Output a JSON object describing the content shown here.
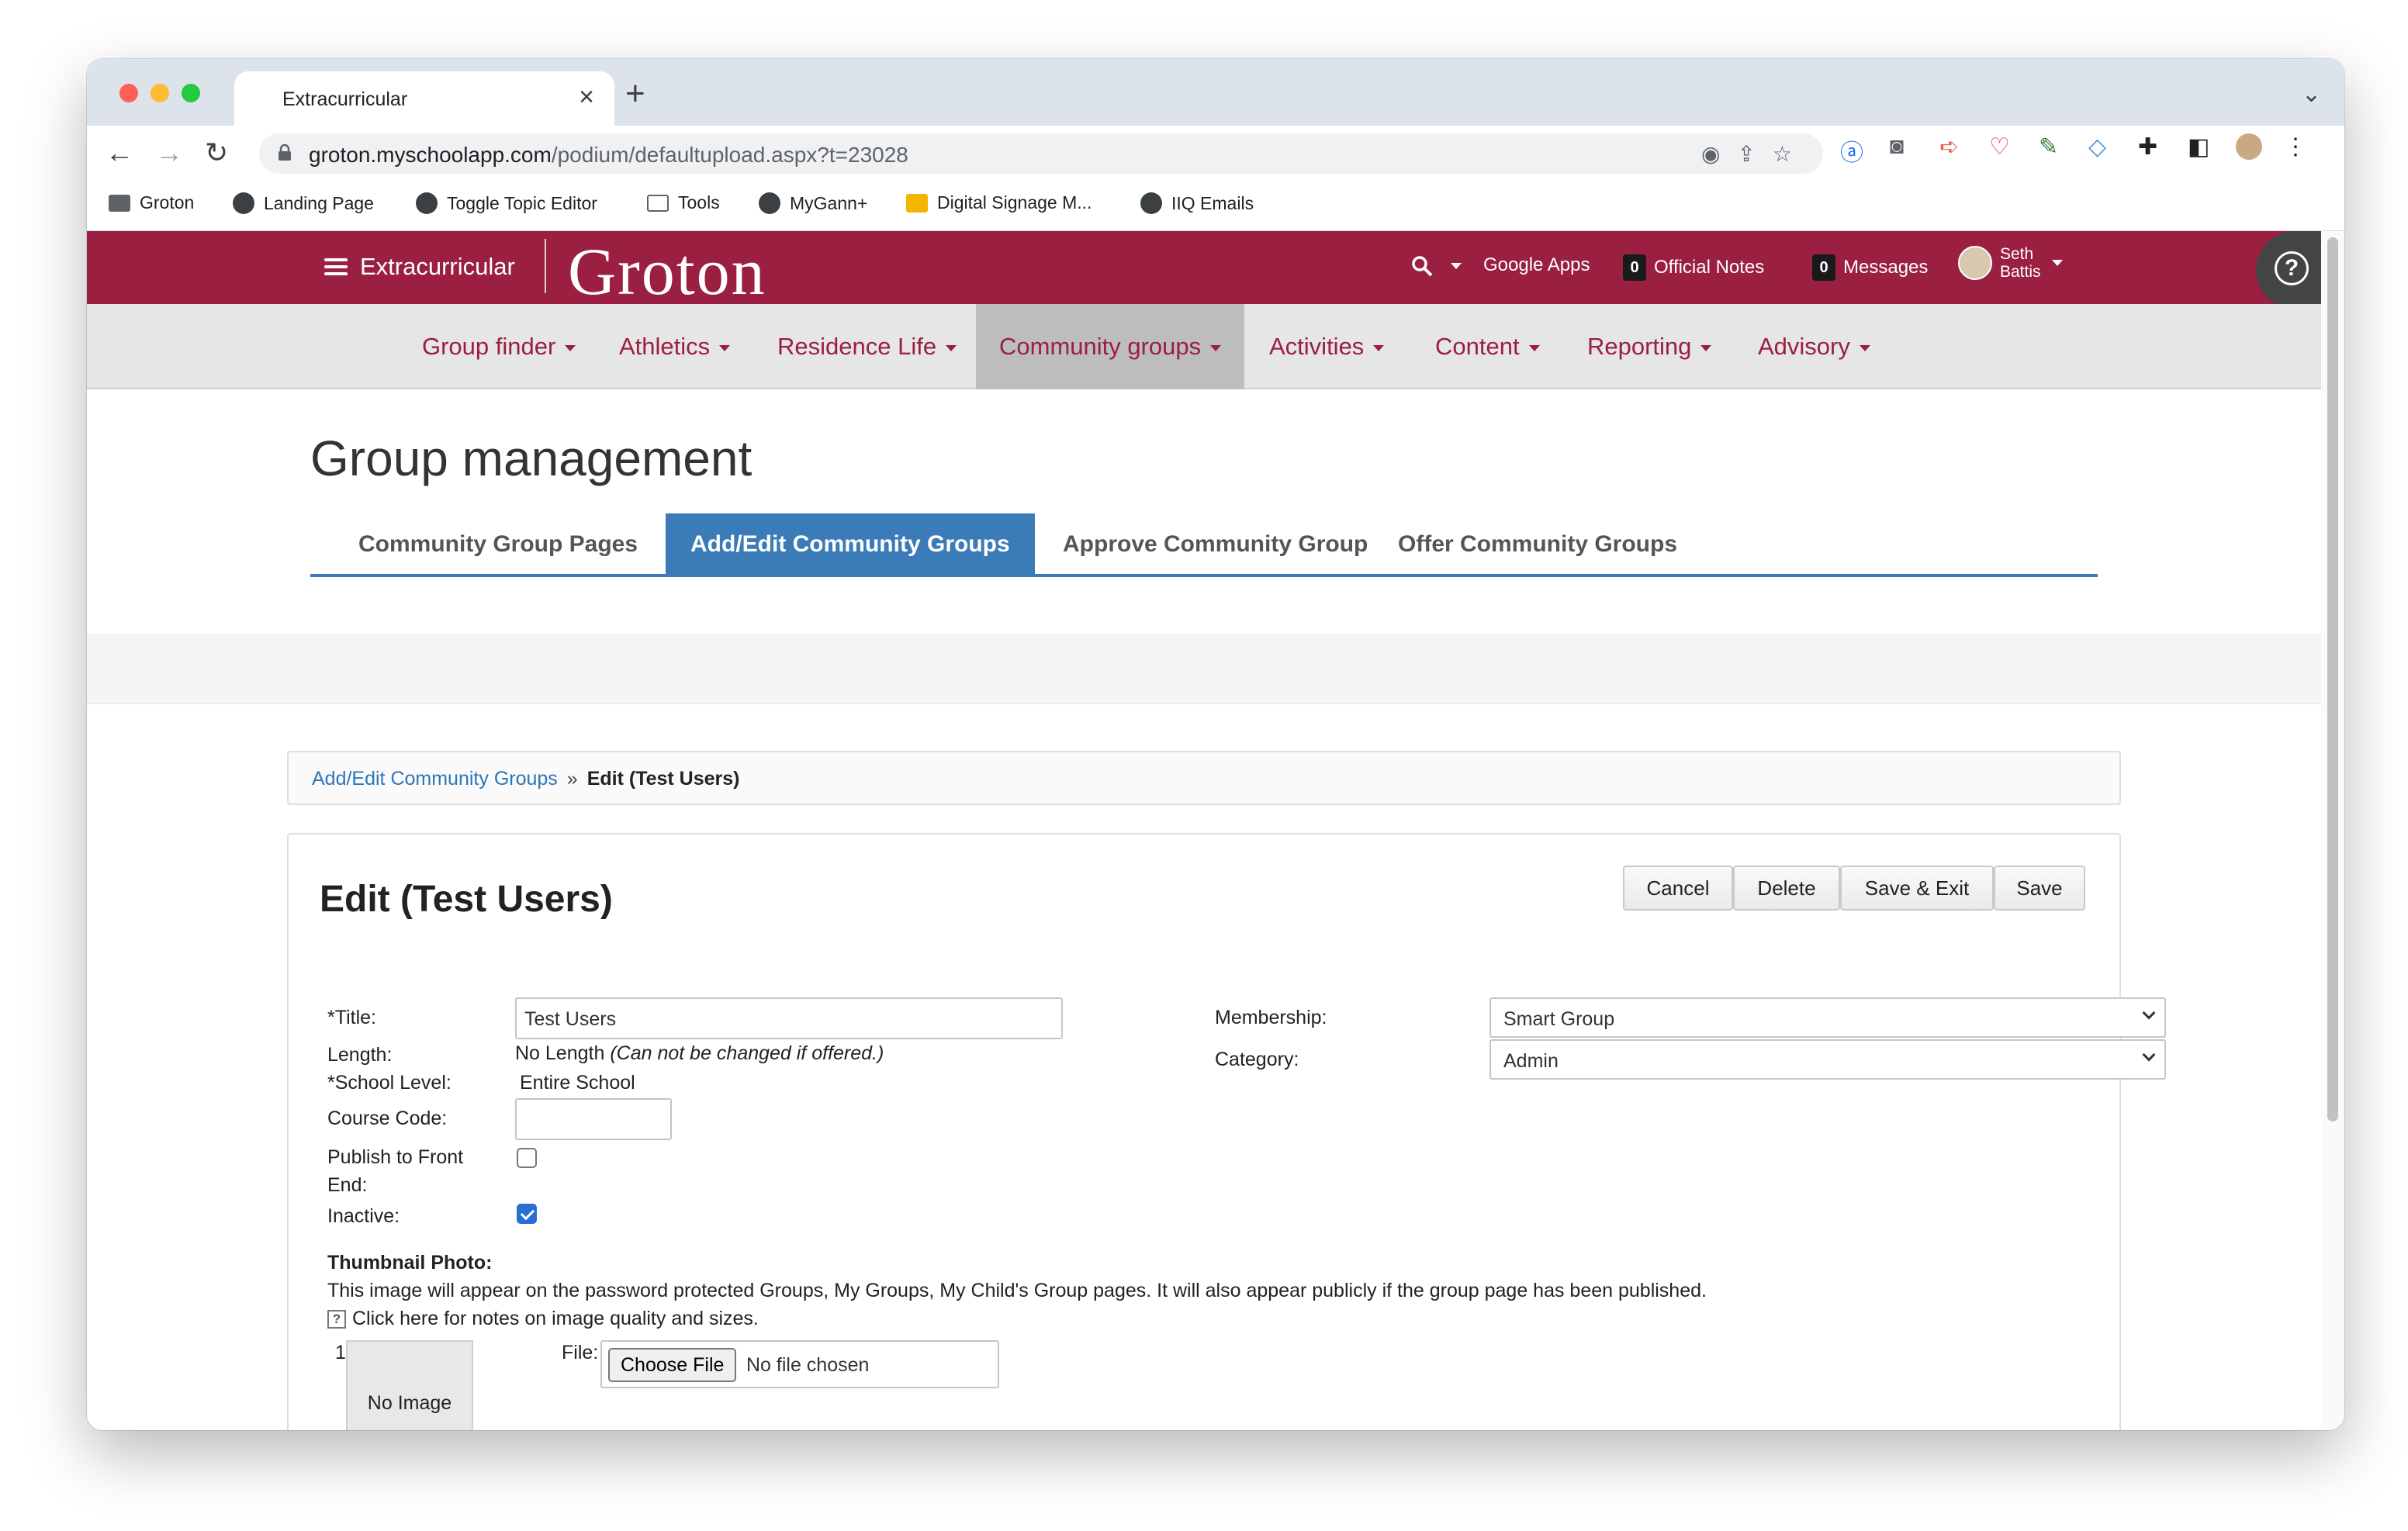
{
  "browser": {
    "tab_title": "Extracurricular",
    "url_host": "groton.myschoolapp.com",
    "url_path": "/podium/defaultupload.aspx?t=23028",
    "bookmarks": [
      "Groton",
      "Landing Page",
      "Toggle Topic Editor",
      "Tools",
      "MyGann+",
      "Digital Signage M...",
      "IIQ Emails"
    ]
  },
  "topbar": {
    "menu_label": "Extracurricular",
    "logo": "Groton",
    "google_apps": "Google Apps",
    "official_notes_count": "0",
    "official_notes": "Official Notes",
    "messages_count": "0",
    "messages": "Messages",
    "user_first": "Seth",
    "user_last": "Battis"
  },
  "mainnav": [
    "Group finder",
    "Athletics",
    "Residence Life",
    "Community groups",
    "Activities",
    "Content",
    "Reporting",
    "Advisory"
  ],
  "page": {
    "title": "Group management",
    "subtabs": [
      "Community Group Pages",
      "Add/Edit Community Groups",
      "Approve Community Group",
      "Offer Community Groups"
    ]
  },
  "breadcrumb": {
    "link": "Add/Edit Community Groups",
    "separator": "»",
    "current": "Edit (Test Users)"
  },
  "form": {
    "heading": "Edit (Test Users)",
    "buttons": {
      "cancel": "Cancel",
      "delete": "Delete",
      "save_exit": "Save & Exit",
      "save": "Save"
    },
    "title_label": "*Title:",
    "title_value": "Test Users",
    "length_label": "Length:",
    "length_value": "No Length",
    "length_note": "(Can not be changed if offered.)",
    "school_level_label": "*School Level:",
    "school_level_value": "Entire School",
    "course_code_label": "Course Code:",
    "publish_label_1": "Publish to Front",
    "publish_label_2": "End:",
    "publish_checked": false,
    "inactive_label": "Inactive:",
    "inactive_checked": true,
    "membership_label": "Membership:",
    "membership_value": "Smart Group",
    "category_label": "Category:",
    "category_value": "Admin",
    "thumbnail_label": "Thumbnail Photo:",
    "thumbnail_desc": "This image will appear on the password protected Groups, My Groups, My Child's Group pages. It will also appear publicly if the group page has been published.",
    "thumbnail_help_icon": "?",
    "thumbnail_help": "Click here for notes on image quality and sizes.",
    "item_number": "1.",
    "no_image": "No Image",
    "file_label": "File:",
    "choose_file": "Choose File",
    "no_file": "No file chosen"
  }
}
